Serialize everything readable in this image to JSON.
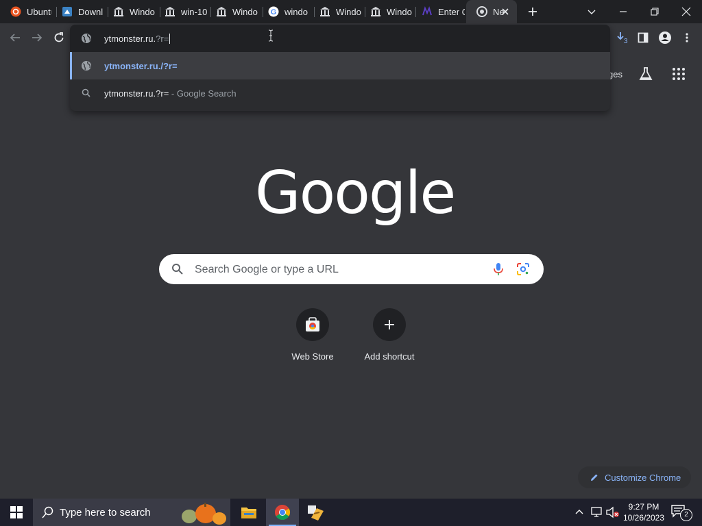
{
  "tabs": [
    {
      "title": "Ubuntu",
      "icon": "ubuntu-icon"
    },
    {
      "title": "Downl",
      "icon": "download-page-icon"
    },
    {
      "title": "Windo",
      "icon": "museum-icon"
    },
    {
      "title": "win-10",
      "icon": "museum-icon"
    },
    {
      "title": "Windo",
      "icon": "museum-icon"
    },
    {
      "title": "windo",
      "icon": "google-icon"
    },
    {
      "title": "Windo",
      "icon": "museum-icon"
    },
    {
      "title": "Windo",
      "icon": "museum-icon"
    },
    {
      "title": "Enter C",
      "icon": "purple-logo-icon"
    },
    {
      "title": "Ne",
      "icon": "chrome-icon",
      "active": true
    }
  ],
  "omnibox": {
    "typed_text": "ytmonster.ru.",
    "autocomplete_text": "?r=",
    "suggestion_url": "ytmonster.ru./?r=",
    "search_query": "ytmonster.ru.?r=",
    "search_suffix": " - Google Search"
  },
  "toolbar": {
    "download_badge": "3"
  },
  "ntp": {
    "images_link_partial": "ges",
    "logo_text": "Google",
    "search_placeholder": "Search Google or type a URL",
    "shortcuts": [
      {
        "label": "Web Store"
      },
      {
        "label": "Add shortcut"
      }
    ],
    "customize_label": "Customize Chrome"
  },
  "taskbar": {
    "search_placeholder": "Type here to search",
    "time": "9:27 PM",
    "date": "10/26/2023",
    "notification_count": "2"
  },
  "colors": {
    "accent": "#8ab4f8",
    "background": "#35363a",
    "tabstrip": "#202124"
  }
}
